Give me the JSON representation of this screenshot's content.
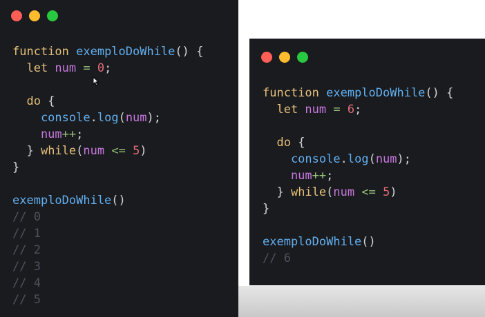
{
  "colors": {
    "keyword": "#e5c07b",
    "function_name": "#61afef",
    "variable": "#c678dd",
    "operator": "#98c379",
    "number": "#e06c75",
    "plain": "#d4d4d4",
    "comment": "#4f525a",
    "dot_red": "#ff5f57",
    "dot_yellow": "#febc2e",
    "dot_green": "#28c840"
  },
  "left_window": {
    "lines": [
      [
        {
          "t": "function ",
          "c": "keyword"
        },
        {
          "t": "exemploDoWhile",
          "c": "function_name"
        },
        {
          "t": "() {",
          "c": "plain"
        }
      ],
      [
        {
          "t": "  let ",
          "c": "keyword"
        },
        {
          "t": "num",
          "c": "variable"
        },
        {
          "t": " = ",
          "c": "operator"
        },
        {
          "t": "0",
          "c": "number"
        },
        {
          "t": ";",
          "c": "plain"
        }
      ],
      [],
      [
        {
          "t": "  do",
          "c": "keyword"
        },
        {
          "t": " {",
          "c": "plain"
        }
      ],
      [
        {
          "t": "    console",
          "c": "function_name"
        },
        {
          "t": ".",
          "c": "plain"
        },
        {
          "t": "log",
          "c": "function_name"
        },
        {
          "t": "(",
          "c": "plain"
        },
        {
          "t": "num",
          "c": "variable"
        },
        {
          "t": ");",
          "c": "plain"
        }
      ],
      [
        {
          "t": "    num",
          "c": "variable"
        },
        {
          "t": "++",
          "c": "operator"
        },
        {
          "t": ";",
          "c": "plain"
        }
      ],
      [
        {
          "t": "  } ",
          "c": "plain"
        },
        {
          "t": "while",
          "c": "keyword"
        },
        {
          "t": "(",
          "c": "plain"
        },
        {
          "t": "num",
          "c": "variable"
        },
        {
          "t": " <= ",
          "c": "operator"
        },
        {
          "t": "5",
          "c": "number"
        },
        {
          "t": ")",
          "c": "plain"
        }
      ],
      [
        {
          "t": "}",
          "c": "plain"
        }
      ],
      [],
      [
        {
          "t": "exemploDoWhile",
          "c": "function_name"
        },
        {
          "t": "()",
          "c": "plain"
        }
      ],
      [
        {
          "t": "// 0",
          "c": "comment"
        }
      ],
      [
        {
          "t": "// 1",
          "c": "comment"
        }
      ],
      [
        {
          "t": "// 2",
          "c": "comment"
        }
      ],
      [
        {
          "t": "// 3",
          "c": "comment"
        }
      ],
      [
        {
          "t": "// 4",
          "c": "comment"
        }
      ],
      [
        {
          "t": "// 5",
          "c": "comment"
        }
      ]
    ]
  },
  "right_window": {
    "lines": [
      [
        {
          "t": "function ",
          "c": "keyword"
        },
        {
          "t": "exemploDoWhile",
          "c": "function_name"
        },
        {
          "t": "() {",
          "c": "plain"
        }
      ],
      [
        {
          "t": "  let ",
          "c": "keyword"
        },
        {
          "t": "num",
          "c": "variable"
        },
        {
          "t": " = ",
          "c": "operator"
        },
        {
          "t": "6",
          "c": "number"
        },
        {
          "t": ";",
          "c": "plain"
        }
      ],
      [],
      [
        {
          "t": "  do",
          "c": "keyword"
        },
        {
          "t": " {",
          "c": "plain"
        }
      ],
      [
        {
          "t": "    console",
          "c": "function_name"
        },
        {
          "t": ".",
          "c": "plain"
        },
        {
          "t": "log",
          "c": "function_name"
        },
        {
          "t": "(",
          "c": "plain"
        },
        {
          "t": "num",
          "c": "variable"
        },
        {
          "t": ");",
          "c": "plain"
        }
      ],
      [
        {
          "t": "    num",
          "c": "variable"
        },
        {
          "t": "++",
          "c": "operator"
        },
        {
          "t": ";",
          "c": "plain"
        }
      ],
      [
        {
          "t": "  } ",
          "c": "plain"
        },
        {
          "t": "while",
          "c": "keyword"
        },
        {
          "t": "(",
          "c": "plain"
        },
        {
          "t": "num",
          "c": "variable"
        },
        {
          "t": " <= ",
          "c": "operator"
        },
        {
          "t": "5",
          "c": "number"
        },
        {
          "t": ")",
          "c": "plain"
        }
      ],
      [
        {
          "t": "}",
          "c": "plain"
        }
      ],
      [],
      [
        {
          "t": "exemploDoWhile",
          "c": "function_name"
        },
        {
          "t": "()",
          "c": "plain"
        }
      ],
      [
        {
          "t": "// 6",
          "c": "comment"
        }
      ]
    ]
  }
}
